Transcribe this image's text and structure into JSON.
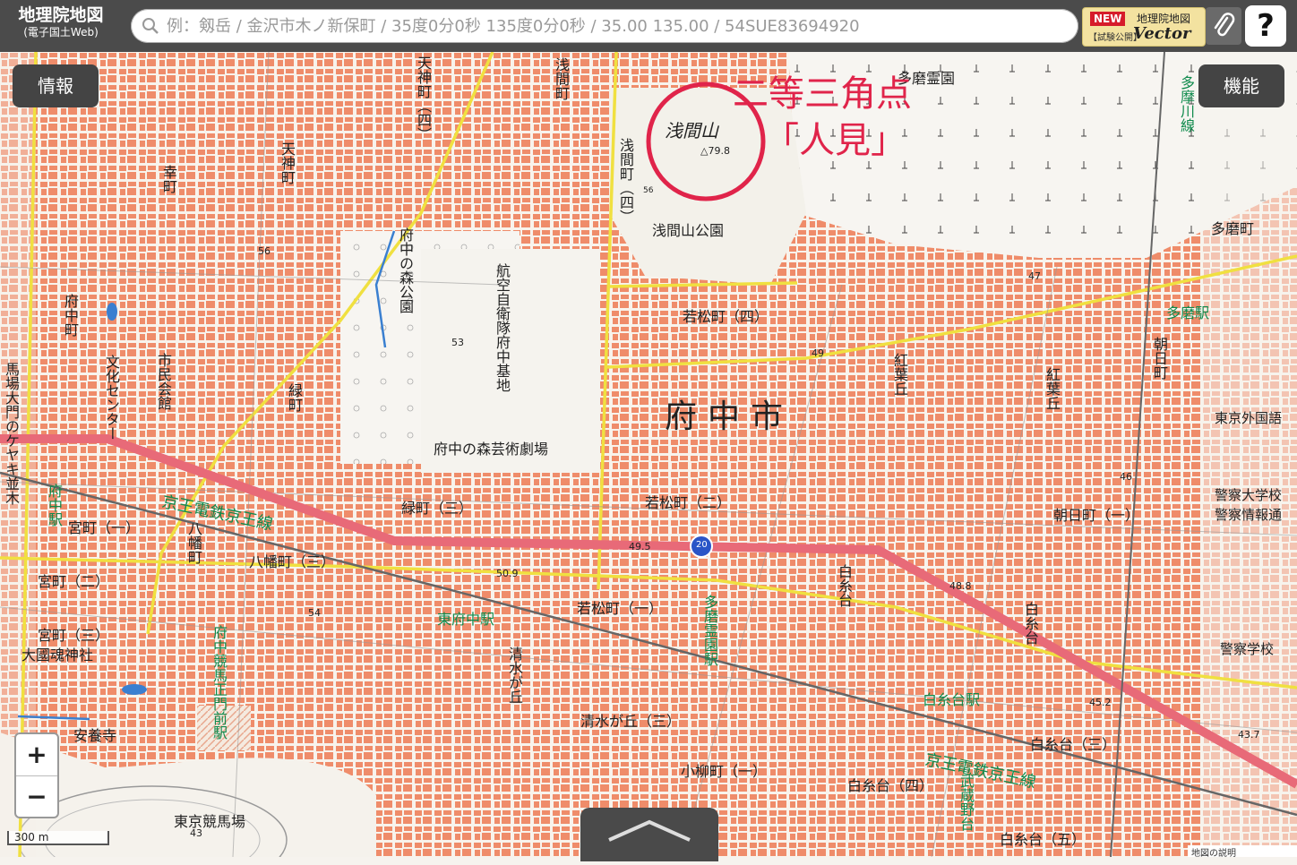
{
  "header": {
    "logo_main": "地理院地図",
    "logo_sub": "(電子国土Web)",
    "search_placeholder": "例：剱岳 / 金沢市木ノ新保町 / 35度0分0秒 135度0分0秒 / 35.00 135.00 / 54SUE83694920",
    "vector_new": "NEW",
    "vector_trial": "【試験公開】",
    "vector_name": "地理院地図",
    "vector_title": "Vector",
    "help": "?"
  },
  "buttons": {
    "info": "情報",
    "functions": "機能",
    "zoom_in": "+",
    "zoom_out": "−"
  },
  "scale": "300 m",
  "annotation": {
    "line1": "二等三角点",
    "line2": "「人見」"
  },
  "map_labels": {
    "city": "府中市",
    "sengenyama": "浅間山",
    "triangulation_elev": "△79.8",
    "sengenyama_park": "浅間山公園",
    "tama_cemetery": "多磨霊園",
    "wakamatsu4": "若松町（四）",
    "wakamatsu2": "若松町（二）",
    "wakamatsu1": "若松町（一）",
    "midori3": "緑町（三）",
    "hachiman3": "八幡町（三）",
    "miyamachi1": "宮町（一）",
    "miyamachi2": "宮町（二）",
    "miyamachi3": "宮町（三）",
    "okunitama": "大國魂神社",
    "anyoji": "安養寺",
    "keibajo": "東京競馬場",
    "shimizugaoka3": "清水が丘（三）",
    "koyanagi1": "小柳町（一）",
    "shiraitodai3": "白糸台（三）",
    "shiraitodai4": "白糸台（四）",
    "shiraitodai5": "白糸台（五）",
    "asahicho1": "朝日町（一）",
    "tamacho": "多磨町",
    "keisatsu_daigakko": "警察大学校",
    "keisatsu_joho": "警察情報通",
    "keisatsu_gakko": "警察学校",
    "gaigo": "東京外国語",
    "keio_line": "京王電鉄京王線",
    "keio_line2": "京王電鉄京王線",
    "higashifuchu_sta": "東府中駅",
    "tama_sta": "多磨駅",
    "shiraitodai_sta": "白糸台駅",
    "geijutsu": "府中の森芸術劇場",
    "mori_koen": "府中の森公園",
    "koku_jieitai": "航空自衛隊府中基地",
    "fuchu_sta": "府中駅",
    "tamareien_sta": "多磨霊園駅",
    "tamagawa_line": "多摩川線",
    "bunka_center": "文化センター",
    "shimin_kaikan": "市民会館",
    "tenjin": "天神町",
    "tenjin4": "天神町（四）",
    "sengen_cho": "浅間町",
    "sengen_cho4": "浅間町（四）",
    "saiwai": "幸町",
    "fuchu_cho": "府中町",
    "midori_cho": "緑町",
    "koyo_oka": "紅葉丘",
    "koyo_oka2": "紅葉丘",
    "asahi_cho": "朝日町",
    "hachiman_cho": "八幡町",
    "baba_daimon": "馬場大門のケヤキ並木",
    "keiba_seimon": "府中競馬正門前駅",
    "shimizugaoka": "清水が丘",
    "shiraitodai": "白糸台",
    "shiraitodai_v": "白糸台",
    "musashino": "武蔵野台",
    "route20": "20",
    "elev_56": "56",
    "elev_53": "53",
    "elev_54": "54",
    "elev_49": "49",
    "elev_495": "49.5",
    "elev_509": "50.9",
    "elev_488": "48.8",
    "elev_47": "47",
    "elev_46": "46",
    "elev_452": "45.2",
    "elev_437": "43.7",
    "elev_43": "43",
    "corner_text": "地図の説明"
  },
  "colors": {
    "buildings": "#ef8c6a",
    "rail": "#e86a78",
    "roads": "#f0e040",
    "annotation": "#e0244a"
  }
}
